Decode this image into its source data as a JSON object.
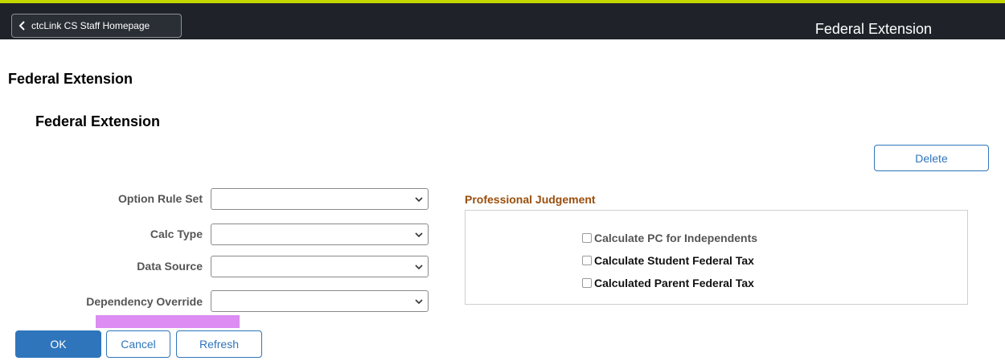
{
  "header": {
    "back_label": "ctcLink CS Staff Homepage",
    "title": "Federal Extension"
  },
  "page": {
    "title": "Federal Extension",
    "subtitle": "Federal Extension"
  },
  "actions": {
    "delete_label": "Delete",
    "ok_label": "OK",
    "cancel_label": "Cancel",
    "refresh_label": "Refresh"
  },
  "fields": [
    {
      "label": "Option Rule Set",
      "value": ""
    },
    {
      "label": "Calc Type",
      "value": ""
    },
    {
      "label": "Data Source",
      "value": ""
    },
    {
      "label": "Dependency Override",
      "value": ""
    }
  ],
  "professional_judgement": {
    "title": "Professional Judgement",
    "options": [
      {
        "label": "Calculate PC for Independents",
        "checked": false
      },
      {
        "label": "Calculate Student Federal Tax",
        "checked": false
      },
      {
        "label": "Calculated Parent Federal Tax",
        "checked": false
      }
    ]
  },
  "colors": {
    "header_bg": "#1f2329",
    "accent_line": "#c4d600",
    "primary": "#2f75bb",
    "section_title": "#9a4e0c",
    "highlight": "#dc8cf2"
  }
}
